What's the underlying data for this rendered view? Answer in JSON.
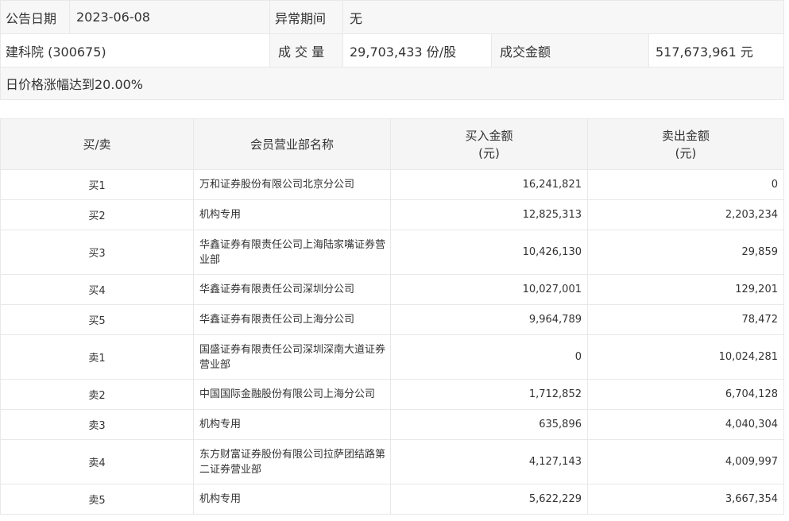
{
  "info": {
    "announce_date_label": "公告日期",
    "announce_date_value": "2023-06-08",
    "abnormal_period_label": "异常期间",
    "abnormal_period_value": "无",
    "stock_name": "建科院 (300675)",
    "volume_label": "成 交 量",
    "volume_value": "29,703,433 份/股",
    "amount_label": "成交金额",
    "amount_value": "517,673,961 元",
    "reason": "日价格涨幅达到20.00%"
  },
  "table": {
    "headers": {
      "side": "买/卖",
      "member": "会员营业部名称",
      "buy_amount_line1": "买入金额",
      "buy_amount_line2": "(元)",
      "sell_amount_line1": "卖出金额",
      "sell_amount_line2": "(元)"
    },
    "rows": [
      {
        "side": "买1",
        "member": "万和证券股份有限公司北京分公司",
        "buy": "16,241,821",
        "sell": "0"
      },
      {
        "side": "买2",
        "member": "机构专用",
        "buy": "12,825,313",
        "sell": "2,203,234"
      },
      {
        "side": "买3",
        "member": "华鑫证券有限责任公司上海陆家嘴证券营业部",
        "buy": "10,426,130",
        "sell": "29,859"
      },
      {
        "side": "买4",
        "member": "华鑫证券有限责任公司深圳分公司",
        "buy": "10,027,001",
        "sell": "129,201"
      },
      {
        "side": "买5",
        "member": "华鑫证券有限责任公司上海分公司",
        "buy": "9,964,789",
        "sell": "78,472"
      },
      {
        "side": "卖1",
        "member": "国盛证券有限责任公司深圳深南大道证券营业部",
        "buy": "0",
        "sell": "10,024,281"
      },
      {
        "side": "卖2",
        "member": "中国国际金融股份有限公司上海分公司",
        "buy": "1,712,852",
        "sell": "6,704,128"
      },
      {
        "side": "卖3",
        "member": "机构专用",
        "buy": "635,896",
        "sell": "4,040,304"
      },
      {
        "side": "卖4",
        "member": "东方财富证券股份有限公司拉萨团结路第二证券营业部",
        "buy": "4,127,143",
        "sell": "4,009,997"
      },
      {
        "side": "卖5",
        "member": "机构专用",
        "buy": "5,622,229",
        "sell": "3,667,354"
      }
    ]
  }
}
